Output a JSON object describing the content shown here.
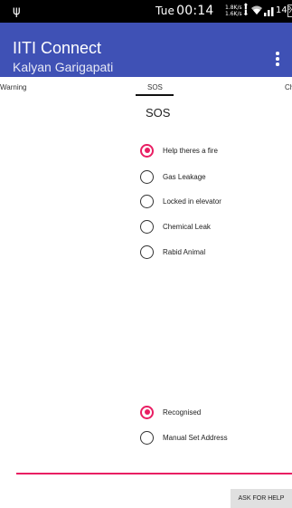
{
  "status_bar": {
    "day": "Tue",
    "time": "00:14",
    "net_speed_up": "1.8K/s",
    "net_speed_down": "1.6K/s",
    "battery_text": "14%",
    "icons": [
      "usb-icon",
      "wifi-icon",
      "signal-icon",
      "battery-icon"
    ]
  },
  "toolbar": {
    "title": "IITI Connect",
    "subtitle": "Kalyan Garigapati",
    "color": "#3f51b5"
  },
  "tabs": [
    {
      "label": "Warning"
    },
    {
      "label": "SOS",
      "selected": true
    },
    {
      "label": "Ch"
    }
  ],
  "main": {
    "section_title": "SOS",
    "emergency_options": [
      {
        "label": "Help theres a fire",
        "checked": true
      },
      {
        "label": "Gas Leakage",
        "checked": false
      },
      {
        "label": "Locked in elevator",
        "checked": false
      },
      {
        "label": "Chemical Leak",
        "checked": false
      },
      {
        "label": "Rabid Animal",
        "checked": false
      }
    ],
    "address_options": [
      {
        "label": "Recognised",
        "checked": true
      },
      {
        "label": "Manual Set Address",
        "checked": false
      }
    ]
  },
  "actions": {
    "ask_for_help_label": "ASK FOR HELP"
  },
  "colors": {
    "accent": "#e91e63",
    "primary": "#3f51b5"
  }
}
